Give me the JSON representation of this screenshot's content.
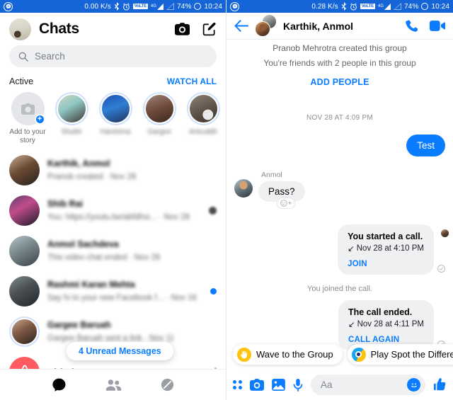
{
  "status_bar": {
    "left": {
      "net_speed_left": "0.00 K/s",
      "net_speed_right": "0.28 K/s"
    },
    "volte_label": "VoLTE",
    "network_type": "4G",
    "battery": "74%",
    "clock": "10:24",
    "icons": [
      "messenger-icon",
      "bluetooth-icon",
      "alarm-icon",
      "volte-icon",
      "signal-icon",
      "signal-secondary-icon",
      "battery-icon"
    ]
  },
  "left_panel": {
    "header": {
      "title": "Chats",
      "avatar": "profile-avatar",
      "camera_label": "Camera",
      "compose_label": "New message"
    },
    "search": {
      "placeholder": "Search",
      "icon": "search-icon"
    },
    "active_section": {
      "label": "Active",
      "watch_all": "WATCH ALL"
    },
    "stories": [
      {
        "name": "Add to your\nstory",
        "type": "add",
        "blurred": false
      },
      {
        "name": "Shubh",
        "type": "friend",
        "blurred": true
      },
      {
        "name": "Harshima",
        "type": "friend",
        "blurred": true
      },
      {
        "name": "Gargee",
        "type": "friend",
        "blurred": true
      },
      {
        "name": "Aniruddh",
        "type": "friend",
        "blurred": true
      }
    ],
    "add_story_label_line1": "Add to your",
    "add_story_label_line2": "story",
    "chats": [
      {
        "name": "Karthik, Anmol",
        "preview": "Pranob created · Nov 28",
        "badge": "none",
        "blurred": true
      },
      {
        "name": "Shib Rai",
        "preview": "You: https://youtu.be/abfdhsi... · Nov 28",
        "badge": "seen",
        "blurred": true
      },
      {
        "name": "Anmol Sachdeva",
        "preview": "This video chat ended · Nov 28",
        "badge": "none",
        "blurred": true
      },
      {
        "name": "Rashmi Karan Mehta",
        "preview": "Say hi to your new Facebook f... · Nov 16",
        "badge": "unread",
        "blurred": true
      },
      {
        "name": "Gargee Baruah",
        "preview": "Gargee Baruah sent a link · Nov 11",
        "badge": "none",
        "blurred": true
      }
    ],
    "airbnb_row": {
      "name": "Airbnb",
      "logo": "airbnb-logo",
      "overflow": "more-options"
    },
    "unread_pill": "4 Unread Messages",
    "bottom_nav": [
      {
        "name": "chats-tab",
        "icon": "chat-bubble-icon",
        "active": true
      },
      {
        "name": "people-tab",
        "icon": "people-icon",
        "active": false
      },
      {
        "name": "discover-tab",
        "icon": "discover-icon",
        "active": false
      }
    ]
  },
  "right_panel": {
    "header": {
      "back": "back-arrow",
      "title": "Karthik, Anmol",
      "call": "phone-icon",
      "video": "video-icon"
    },
    "system_messages": {
      "created": "Pranob Mehrotra created this group",
      "friends": "You're friends with 2 people in this group",
      "add_people": "ADD PEOPLE"
    },
    "day_stamp": "NOV 28 AT 4:09 PM",
    "messages": [
      {
        "type": "outgoing",
        "text": "Test"
      },
      {
        "type": "incoming",
        "sender": "Anmol",
        "text": "Pass?"
      }
    ],
    "reaction_button": "add-reaction",
    "call_cards": [
      {
        "title": "You started a call.",
        "time": "Nov 28 at 4:10 PM",
        "action": "JOIN",
        "arrow": "↙"
      },
      {
        "title": "The call ended.",
        "time": "Nov 28 at 4:11 PM",
        "action": "CALL AGAIN",
        "arrow": "↙"
      }
    ],
    "joined_note": "You joined the call.",
    "suggestion_chips": [
      {
        "label": "Wave to the Group",
        "icon": "wave-icon"
      },
      {
        "label": "Play Spot the Difference",
        "icon": "spot-the-difference-icon"
      }
    ],
    "composer": {
      "placeholder": "Aa",
      "icons": [
        "apps-grid-icon",
        "camera-icon",
        "gallery-icon",
        "microphone-icon",
        "emoji-icon",
        "thumbs-up-icon"
      ]
    }
  },
  "colors": {
    "brand_blue": "#0a7cff",
    "status_bar": "#1565d8",
    "bubble_gray": "#eff0f2",
    "airbnb_red": "#ff5a5f"
  }
}
